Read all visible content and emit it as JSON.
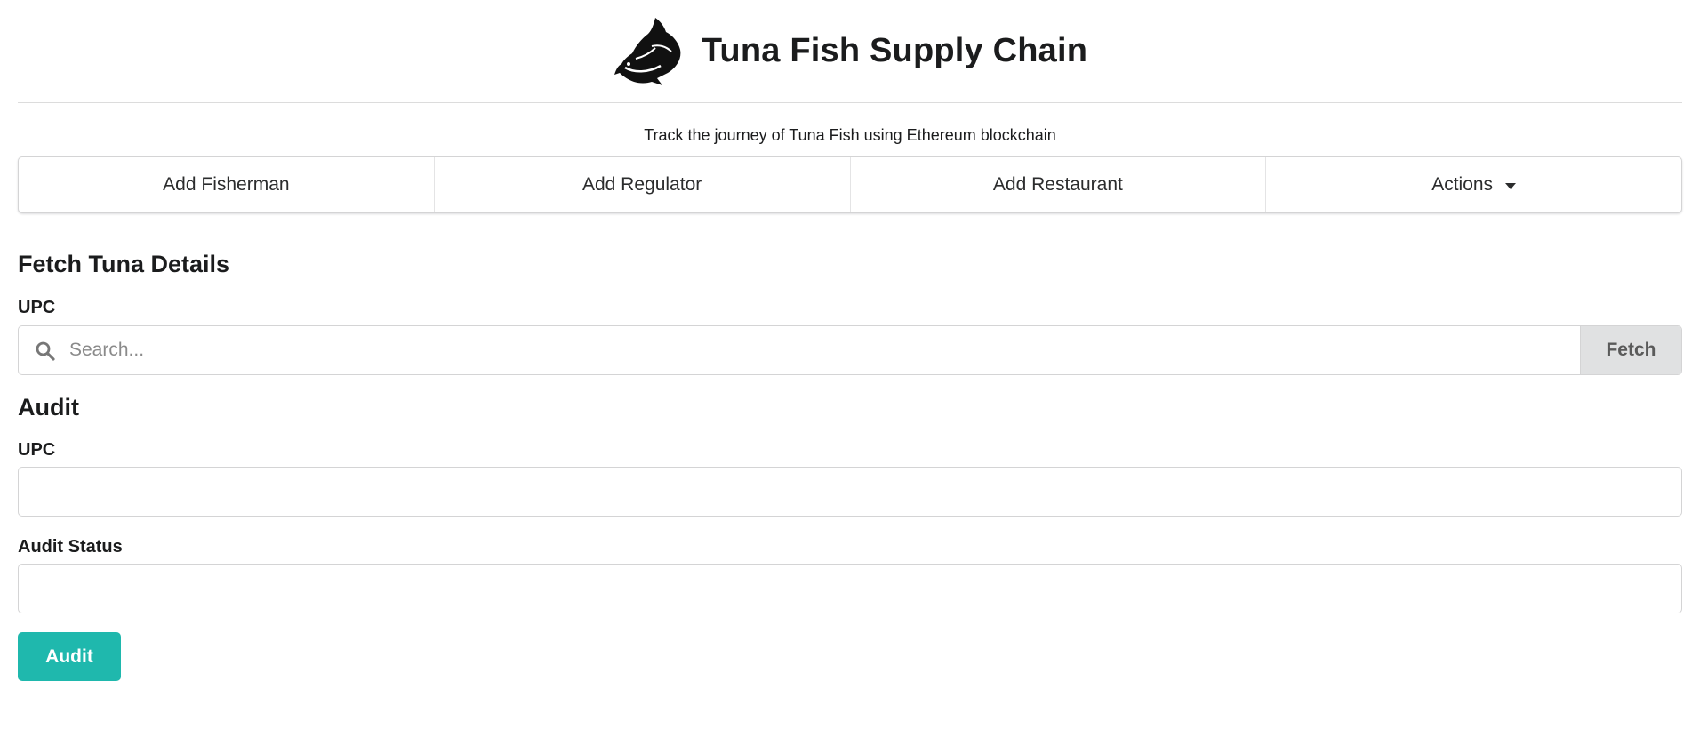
{
  "header": {
    "title": "Tuna Fish Supply Chain",
    "logo_icon": "tuna-fish-icon"
  },
  "subtitle": "Track the journey of Tuna Fish using Ethereum blockchain",
  "menu": {
    "items": [
      {
        "label": "Add Fisherman"
      },
      {
        "label": "Add Regulator"
      },
      {
        "label": "Add Restaurant"
      },
      {
        "label": "Actions",
        "icon": "caret-down-icon"
      }
    ]
  },
  "fetch_section": {
    "title": "Fetch Tuna Details",
    "upc_label": "UPC",
    "search_placeholder": "Search...",
    "search_value": "",
    "fetch_button_label": "Fetch"
  },
  "audit_section": {
    "title": "Audit",
    "upc_label": "UPC",
    "upc_value": "",
    "status_label": "Audit Status",
    "status_value": "",
    "audit_button_label": "Audit"
  },
  "colors": {
    "accent": "#1fb8ad",
    "fetch_button_bg": "#e0e1e2",
    "border": "#d4d4d5"
  }
}
